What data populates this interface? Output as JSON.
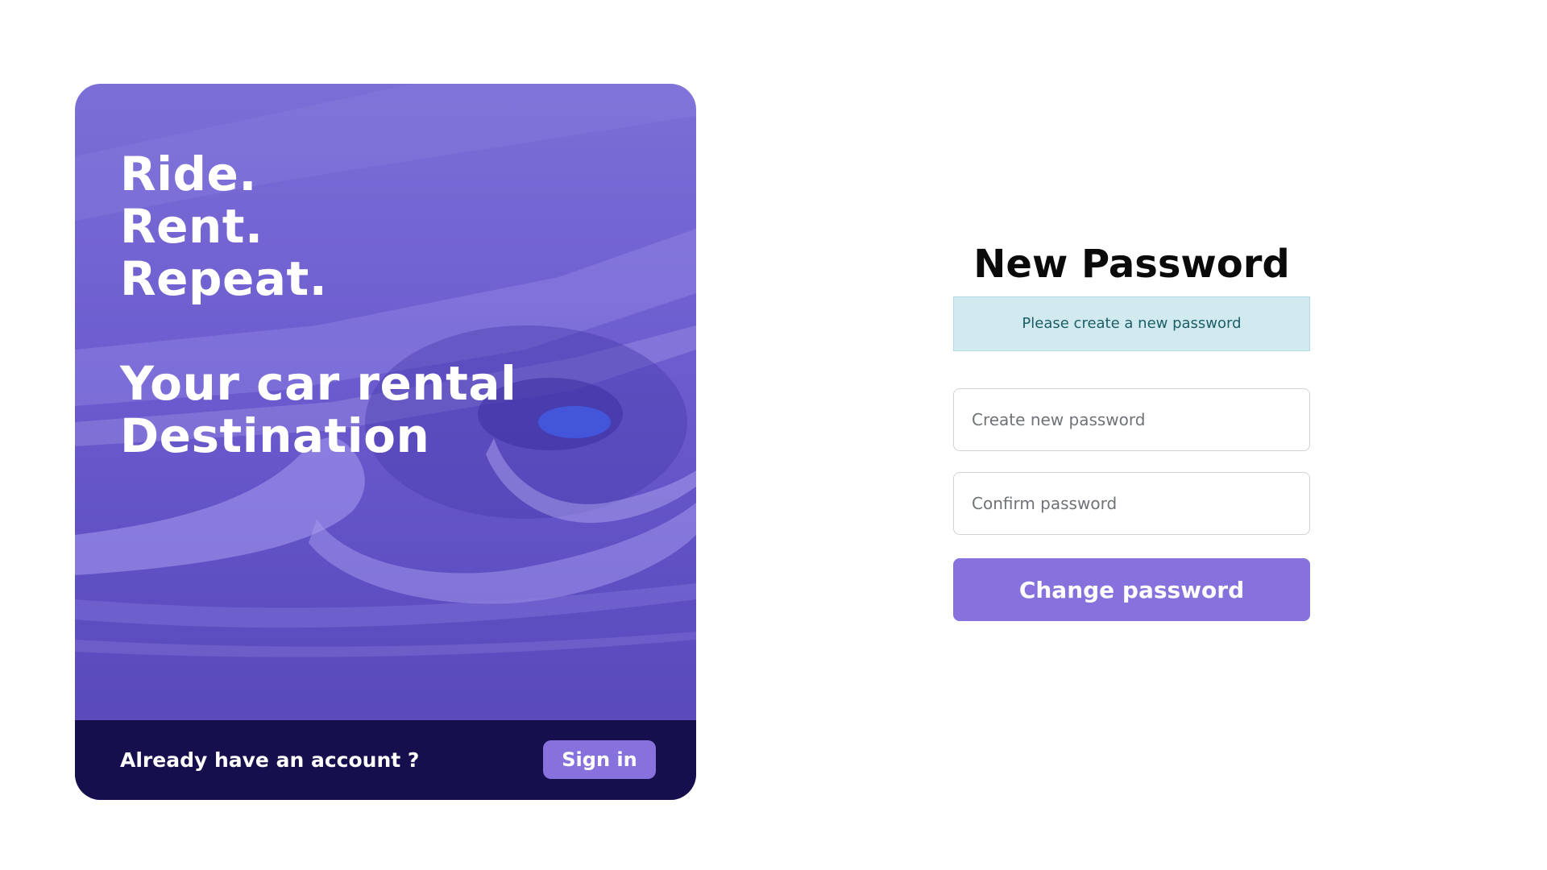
{
  "hero": {
    "line1": "Ride.",
    "line2": "Rent.",
    "line3": "Repeat.",
    "line4": "Your car rental",
    "line5": "Destination",
    "footer_text": "Already have an account ?",
    "signin_label": "Sign in"
  },
  "form": {
    "title": "New Password",
    "banner": "Please create a new password",
    "new_password_placeholder": "Create new password",
    "confirm_password_placeholder": "Confirm password",
    "submit_label": "Change password"
  },
  "colors": {
    "accent": "#8671dd",
    "hero_footer": "#160f4d",
    "banner_bg": "#d1eaef",
    "banner_text": "#1c5d66"
  },
  "icons": {
    "hero_image": "car-headlight-icon"
  }
}
